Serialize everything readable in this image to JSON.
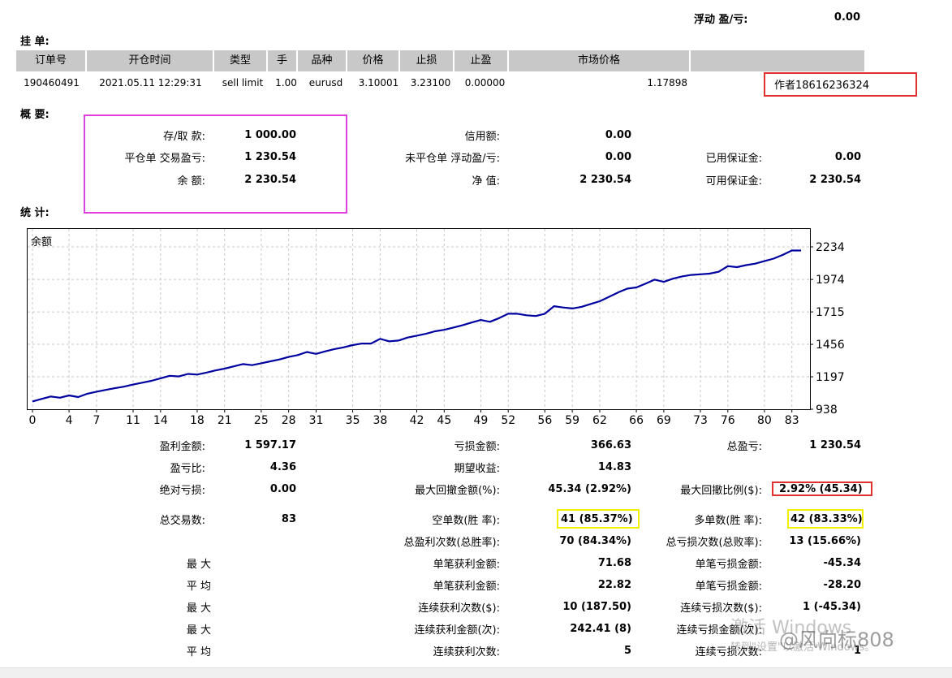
{
  "floating": {
    "label": "浮动 盈/亏:",
    "value": "0.00"
  },
  "pending": {
    "title": "挂 单:",
    "headers": [
      "订单号",
      "开仓时间",
      "类型",
      "手",
      "品种",
      "价格",
      "止损",
      "止盈",
      "市场价格",
      ""
    ],
    "row": {
      "order": "190460491",
      "time": "2021.05.11 12:29:31",
      "type": "sell limit",
      "lots": "1.00",
      "symbol": "eurusd",
      "price": "3.10001",
      "sl": "3.23100",
      "tp": "0.00000",
      "market": "1.17898",
      "comment": "作者18616236324"
    }
  },
  "summary": {
    "title": "概 要:",
    "deposit": {
      "label": "存/取 款:",
      "value": "1 000.00"
    },
    "closed_pl": {
      "label": "平仓单 交易盈亏:",
      "value": "1 230.54"
    },
    "balance": {
      "label": "余 额:",
      "value": "2 230.54"
    },
    "credit": {
      "label": "信用额:",
      "value": "0.00"
    },
    "open_pl": {
      "label": "未平仓单 浮动盈/亏:",
      "value": "0.00"
    },
    "equity": {
      "label": "净 值:",
      "value": "2 230.54"
    },
    "margin": {
      "label": "已用保证金:",
      "value": "0.00"
    },
    "free_margin": {
      "label": "可用保证金:",
      "value": "2 230.54"
    }
  },
  "stats_title": "统 计:",
  "chart_data": {
    "type": "line",
    "legend": "余额",
    "ylim": [
      938,
      2234
    ],
    "yticks": [
      2234,
      1974,
      1715,
      1456,
      1197,
      938
    ],
    "xticks": [
      0,
      4,
      7,
      11,
      14,
      18,
      21,
      25,
      28,
      31,
      35,
      38,
      42,
      45,
      49,
      52,
      56,
      59,
      62,
      66,
      69,
      73,
      76,
      80,
      83
    ],
    "xlim": [
      0,
      84
    ],
    "grid": true,
    "series": [
      {
        "color": "#0000a0",
        "x": [
          0,
          1,
          2,
          3,
          4,
          5,
          6,
          7,
          8,
          9,
          10,
          11,
          12,
          13,
          14,
          15,
          16,
          17,
          18,
          19,
          20,
          21,
          22,
          23,
          24,
          25,
          26,
          27,
          28,
          29,
          30,
          31,
          32,
          33,
          34,
          35,
          36,
          37,
          38,
          39,
          40,
          41,
          42,
          43,
          44,
          45,
          46,
          47,
          48,
          49,
          50,
          51,
          52,
          53,
          54,
          55,
          56,
          57,
          58,
          59,
          60,
          61,
          62,
          63,
          64,
          65,
          66,
          67,
          68,
          69,
          70,
          71,
          72,
          73,
          74,
          75,
          76,
          77,
          78,
          79,
          80,
          81,
          82,
          83,
          84
        ],
        "values": [
          1000,
          1020,
          1040,
          1030,
          1048,
          1035,
          1062,
          1078,
          1092,
          1106,
          1118,
          1135,
          1150,
          1165,
          1185,
          1205,
          1200,
          1220,
          1215,
          1230,
          1248,
          1262,
          1280,
          1298,
          1290,
          1305,
          1320,
          1335,
          1355,
          1370,
          1395,
          1380,
          1400,
          1418,
          1432,
          1450,
          1462,
          1462,
          1500,
          1480,
          1486,
          1510,
          1525,
          1540,
          1560,
          1572,
          1590,
          1608,
          1630,
          1650,
          1636,
          1665,
          1700,
          1700,
          1688,
          1682,
          1700,
          1760,
          1750,
          1742,
          1755,
          1778,
          1800,
          1835,
          1870,
          1900,
          1910,
          1940,
          1972,
          1955,
          1980,
          1998,
          2010,
          2015,
          2020,
          2035,
          2080,
          2072,
          2088,
          2100,
          2120,
          2140,
          2170,
          2205,
          2205
        ]
      }
    ]
  },
  "stats": {
    "gross_profit": {
      "label": "盈利金额:",
      "value": "1 597.17"
    },
    "gross_loss": {
      "label": "亏损金额:",
      "value": "366.63"
    },
    "total_net": {
      "label": "总盈亏:",
      "value": "1 230.54"
    },
    "profit_factor": {
      "label": "盈亏比:",
      "value": "4.36"
    },
    "expected": {
      "label": "期望收益:",
      "value": "14.83"
    },
    "abs_dd": {
      "label": "绝对亏损:",
      "value": "0.00"
    },
    "max_dd": {
      "label": "最大回撤金额(%):",
      "value": "45.34 (2.92%)"
    },
    "rel_dd": {
      "label": "最大回撤比例($):",
      "value": "2.92% (45.34)"
    },
    "total_trades": {
      "label": "总交易数:",
      "value": "83"
    },
    "short": {
      "label": "空单数(胜 率):",
      "value": "41 (85.37%)"
    },
    "long": {
      "label": "多单数(胜 率):",
      "value": "42 (83.33%)"
    },
    "profit_trades": {
      "label": "总盈利次数(总胜率):",
      "value": "70 (84.34%)"
    },
    "loss_trades": {
      "label": "总亏损次数(总败率):",
      "value": "13 (15.66%)"
    },
    "largest_lbl": "最 大",
    "largest_profit": {
      "label": "单笔获利金额:",
      "value": "71.68"
    },
    "largest_loss": {
      "label": "单笔亏损金额:",
      "value": "-45.34"
    },
    "avg_lbl": "平 均",
    "avg_profit": {
      "label": "单笔获利金额:",
      "value": "22.82"
    },
    "avg_loss": {
      "label": "单笔亏损金额:",
      "value": "-28.20"
    },
    "max_lbl1": "最 大",
    "consec_wins": {
      "label": "连续获利次数($):",
      "value": "10 (187.50)"
    },
    "consec_losses": {
      "label": "连续亏损次数($):",
      "value": "1 (-45.34)"
    },
    "max_lbl2": "最 大",
    "consec_profit": {
      "label": "连续获利金额(次):",
      "value": "242.41 (8)"
    },
    "consec_loss": {
      "label": "连续亏损金额(次):",
      "value": ""
    },
    "avg_lbl2": "平 均",
    "avg_consec_wins": {
      "label": "连续获利次数:",
      "value": "5"
    },
    "avg_consec_losses": {
      "label": "连续亏损次数:",
      "value": "1"
    }
  },
  "watermark": {
    "activate": "激活 Windows",
    "goto": "转到\"设置\"以激活 Windows。",
    "brand": "@风向标808"
  }
}
